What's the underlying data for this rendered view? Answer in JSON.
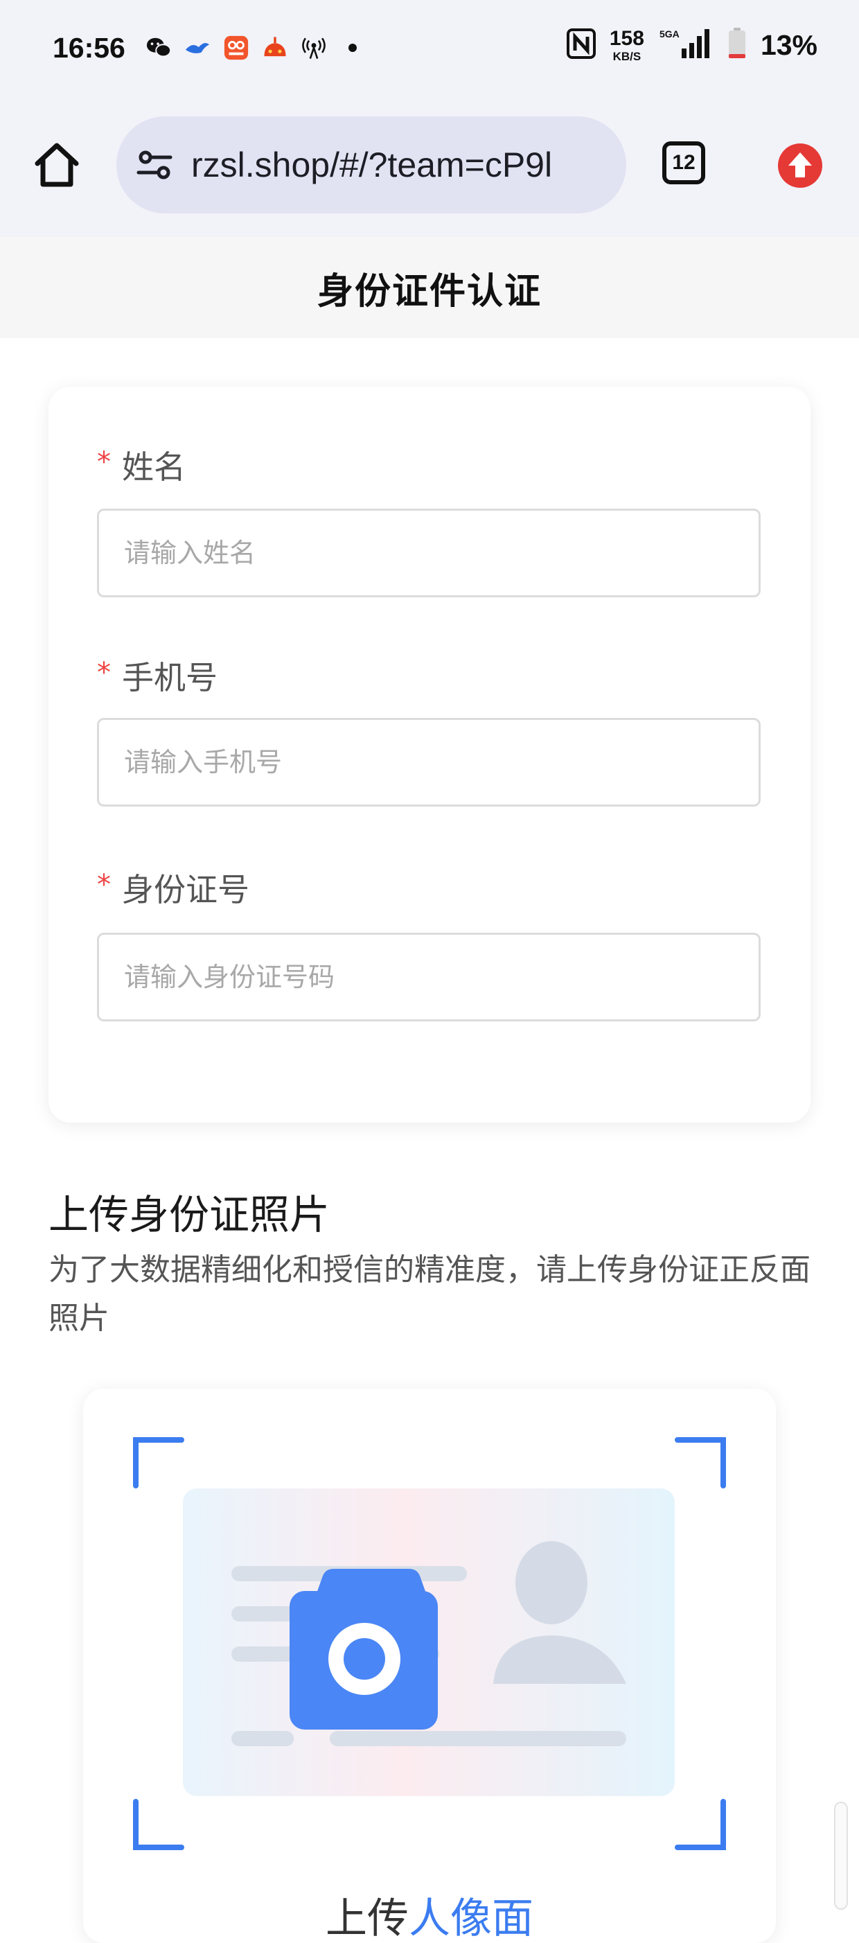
{
  "status_bar": {
    "time": "16:56",
    "net_speed_value": "158",
    "net_speed_unit": "KB/S",
    "battery_percent": "13%",
    "signal_label": "5GA"
  },
  "browser": {
    "url": "rzsl.shop/#/?team=cP9l",
    "tab_count": "12"
  },
  "page": {
    "title": "身份证件认证"
  },
  "form": {
    "required_mark": "*",
    "fields": [
      {
        "label": "姓名",
        "placeholder": "请输入姓名",
        "value": ""
      },
      {
        "label": "手机号",
        "placeholder": "请输入手机号",
        "value": ""
      },
      {
        "label": "身份证号",
        "placeholder": "请输入身份证号码",
        "value": ""
      }
    ]
  },
  "upload": {
    "title": "上传身份证照片",
    "description": "为了大数据精细化和授信的精准度，请上传身份证正反面照片",
    "caption_prefix": "上传",
    "caption_highlight": "人像面",
    "accent_color": "#3b7cf0"
  }
}
